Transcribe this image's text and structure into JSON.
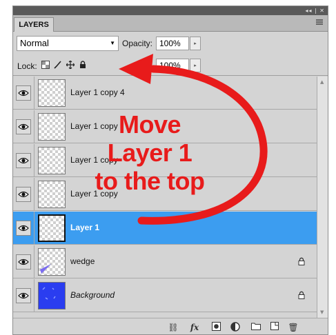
{
  "panel": {
    "collapse_glyph": "◂◂ | ✕",
    "tab_label": "LAYERS",
    "menu_icon": "panel-menu-icon"
  },
  "blend": {
    "mode": "Normal"
  },
  "opacity": {
    "label": "Opacity:",
    "value": "100%"
  },
  "lock": {
    "label": "Lock:"
  },
  "fill": {
    "value": "100%"
  },
  "layers": [
    {
      "name": "Layer 1 copy 4",
      "thumb": "transparent",
      "selected": false
    },
    {
      "name": "Layer 1 copy",
      "thumb": "transparent",
      "selected": false
    },
    {
      "name": "Layer 1 copy",
      "thumb": "transparent",
      "selected": false
    },
    {
      "name": "Layer 1 copy",
      "thumb": "transparent",
      "selected": false
    },
    {
      "name": "Layer 1",
      "thumb": "transparent",
      "selected": true
    },
    {
      "name": "wedge",
      "thumb": "wedge",
      "selected": false,
      "locked": true
    },
    {
      "name": "Background",
      "thumb": "blue",
      "selected": false,
      "locked": true,
      "italic": true
    }
  ],
  "bottom_icons": [
    "link-layers-icon",
    "fx-icon",
    "add-mask-icon",
    "adjustment-layer-icon",
    "new-group-icon",
    "new-layer-icon",
    "delete-layer-icon"
  ],
  "bottom_glyphs": {
    "link": "⛓",
    "fx": "fx",
    "trash": "🗑"
  },
  "callout": {
    "line1": "Move",
    "line2": "Layer 1",
    "line3": "to the top",
    "color": "#e81b1b"
  },
  "colors": {
    "selection": "#3c9df0",
    "panel": "#d4d4d4",
    "background_layer": "#2a3df0"
  }
}
